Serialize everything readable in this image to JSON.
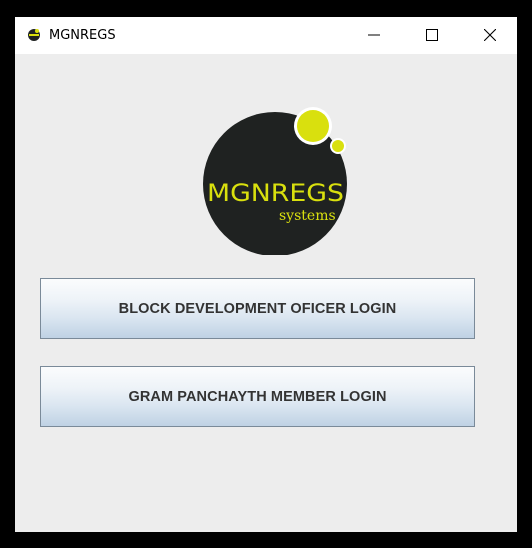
{
  "window": {
    "title": "MGNREGS",
    "controls": {
      "minimize": "minimize-icon",
      "maximize": "maximize-icon",
      "close": "close-icon"
    }
  },
  "logo": {
    "title": "MGNREGS",
    "subtitle": "systems",
    "colors": {
      "circle": "#1f2221",
      "accent": "#d9e00e"
    }
  },
  "buttons": {
    "bdo_login": "BLOCK DEVELOPMENT OFICER LOGIN",
    "gp_login": "GRAM PANCHAYTH MEMBER LOGIN"
  }
}
